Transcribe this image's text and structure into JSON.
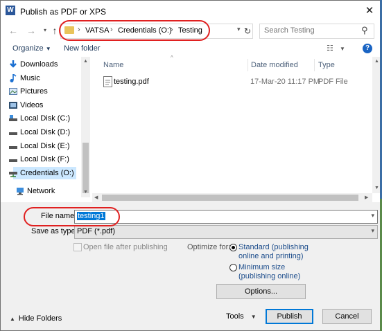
{
  "window": {
    "title": "Publish as PDF or XPS",
    "app_icon": "W",
    "close_glyph": "✕"
  },
  "nav": {
    "breadcrumb": [
      "VATSA",
      "Credentials (O:)",
      "Testing"
    ],
    "search_placeholder": "Search Testing"
  },
  "toolbar": {
    "organize_label": "Organize",
    "new_folder_label": "New folder",
    "help_glyph": "?"
  },
  "sidebar": {
    "items": [
      {
        "label": "Downloads",
        "icon": "download-arrow-icon"
      },
      {
        "label": "Music",
        "icon": "music-note-icon"
      },
      {
        "label": "Pictures",
        "icon": "pictures-icon"
      },
      {
        "label": "Videos",
        "icon": "videos-icon"
      },
      {
        "label": "Local Disk (C:)",
        "icon": "drive-icon"
      },
      {
        "label": "Local Disk (D:)",
        "icon": "drive-icon"
      },
      {
        "label": "Local Disk (E:)",
        "icon": "drive-icon"
      },
      {
        "label": "Local Disk (F:)",
        "icon": "drive-icon"
      },
      {
        "label": "Credentials (O:)",
        "icon": "network-drive-icon",
        "selected": true
      },
      {
        "label": "Network",
        "icon": "network-icon"
      }
    ]
  },
  "file_list": {
    "columns": [
      "Name",
      "Date modified",
      "Type"
    ],
    "rows": [
      {
        "name": "testing.pdf",
        "date": "17-Mar-20 11:17 PM",
        "type": "PDF File"
      }
    ]
  },
  "form": {
    "file_name_label": "File name:",
    "file_name_value": "testing1",
    "save_type_label": "Save as type:",
    "save_type_value": "PDF (*.pdf)",
    "open_after_label": "Open file after publishing",
    "optimize_label": "Optimize for:",
    "opt_standard_line1": "Standard (publishing",
    "opt_standard_line2": "online and printing)",
    "opt_minimum_line1": "Minimum size",
    "opt_minimum_line2": "(publishing online)",
    "options_button": "Options...",
    "hide_folders": "Hide Folders",
    "tools": "Tools",
    "publish_button": "Publish",
    "cancel_button": "Cancel"
  },
  "colors": {
    "accent": "#0078d7",
    "annotation": "#e02020",
    "link": "#1e4e8c",
    "selection": "#cce8ff"
  }
}
